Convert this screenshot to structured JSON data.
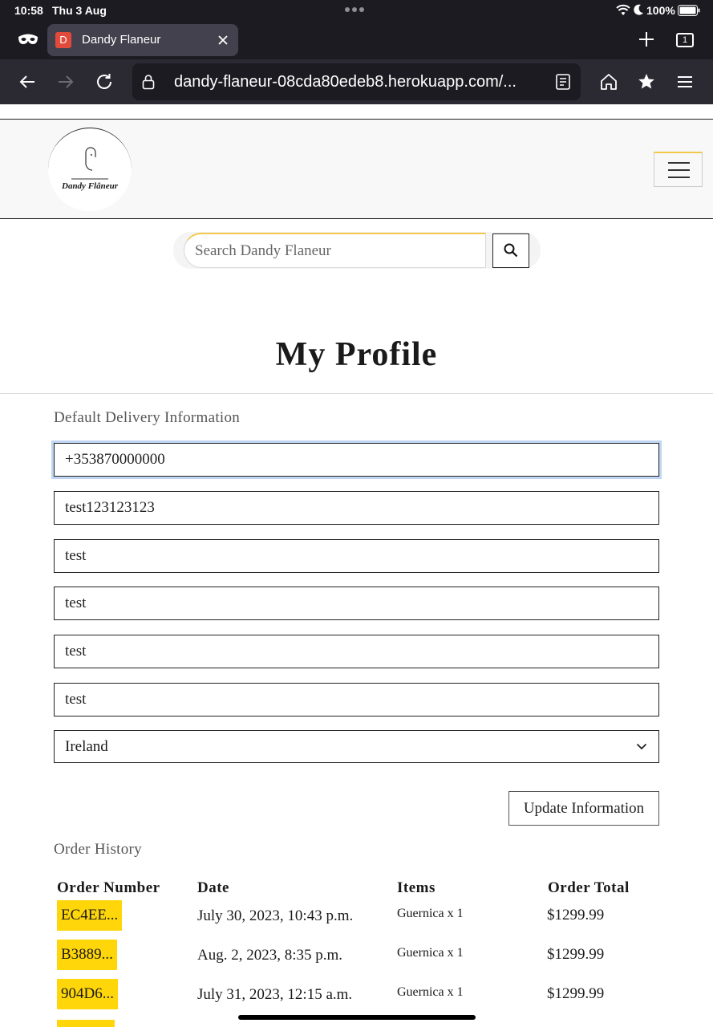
{
  "status_bar": {
    "time": "10:58",
    "date": "Thu 3 Aug",
    "battery": "100%"
  },
  "browser": {
    "tab_title": "Dandy Flaneur",
    "tab_favicon_letter": "D",
    "tab_count": "1",
    "url": "dandy-flaneur-08cda80edeb8.herokuapp.com/...",
    "icons": [
      "private-mask-icon",
      "close-icon",
      "plus-icon",
      "tabs-icon",
      "back-icon",
      "forward-icon",
      "reload-icon",
      "lock-icon",
      "reader-icon",
      "home-icon",
      "bookmark-star-icon",
      "menu-icon"
    ]
  },
  "site": {
    "logo_text": "Dandy Flâneur",
    "search_placeholder": "Search Dandy Flaneur",
    "page_title": "My Profile"
  },
  "delivery": {
    "section_label": "Default Delivery Information",
    "phone": "+353870000000",
    "street_address_1": "test123123123",
    "street_address_2": "test",
    "town_or_city": "test",
    "county": "test",
    "postcode": "test",
    "country": "Ireland",
    "update_label": "Update Information"
  },
  "orders": {
    "section_label": "Order History",
    "headers": [
      "Order Number",
      "Date",
      "Items",
      "Order Total"
    ],
    "rows": [
      {
        "number": "EC4EE...",
        "date": "July 30, 2023, 10:43 p.m.",
        "items": "Guernica x 1",
        "total": "$1299.99"
      },
      {
        "number": "B3889...",
        "date": "Aug. 2, 2023, 8:35 p.m.",
        "items": "Guernica x 1",
        "total": "$1299.99"
      },
      {
        "number": "904D6...",
        "date": "July 31, 2023, 12:15 a.m.",
        "items": "Guernica x 1",
        "total": "$1299.99"
      }
    ]
  },
  "colors": {
    "accent": "#ffd60a",
    "browser_chrome": "#1c1b22",
    "toolbar": "#2b2a33"
  }
}
